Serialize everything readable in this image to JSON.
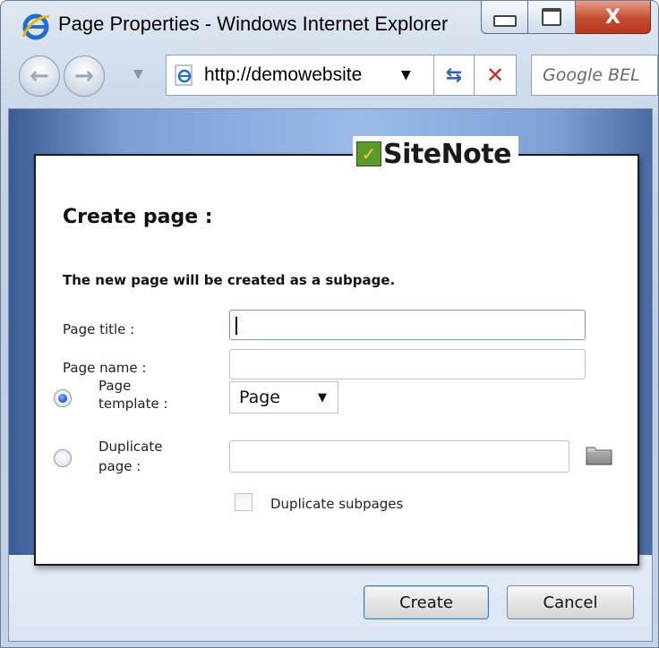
{
  "window": {
    "title": "Page Properties - Windows Internet Explorer",
    "close_glyph": "X"
  },
  "nav": {
    "address": "http://demowebsite",
    "search_placeholder": "Google BEL"
  },
  "brand": {
    "name": "SiteNote",
    "colors": {
      "check_bg": "#5a9a2b",
      "check_mark": "#ffd21e"
    }
  },
  "dialog": {
    "heading": "Create page :",
    "subnote": "The new page will be created as a subpage.",
    "page_title_label": "Page title :",
    "page_title_value": "",
    "page_name_label": "Page name :",
    "page_name_value": "",
    "template_label_line1": "Page",
    "template_label_line2": "template :",
    "template_selected": "Page",
    "template_radio_selected": true,
    "duplicate_label_line1": "Duplicate",
    "duplicate_label_line2": "page :",
    "duplicate_value": "",
    "duplicate_radio_selected": false,
    "duplicate_subpages_label": "Duplicate subpages",
    "duplicate_subpages_checked": false
  },
  "buttons": {
    "create": "Create",
    "cancel": "Cancel"
  },
  "icons": {
    "ie_logo": "internet-explorer-icon",
    "folder": "folder-icon",
    "refresh": "refresh-icon",
    "stop": "stop-icon"
  }
}
